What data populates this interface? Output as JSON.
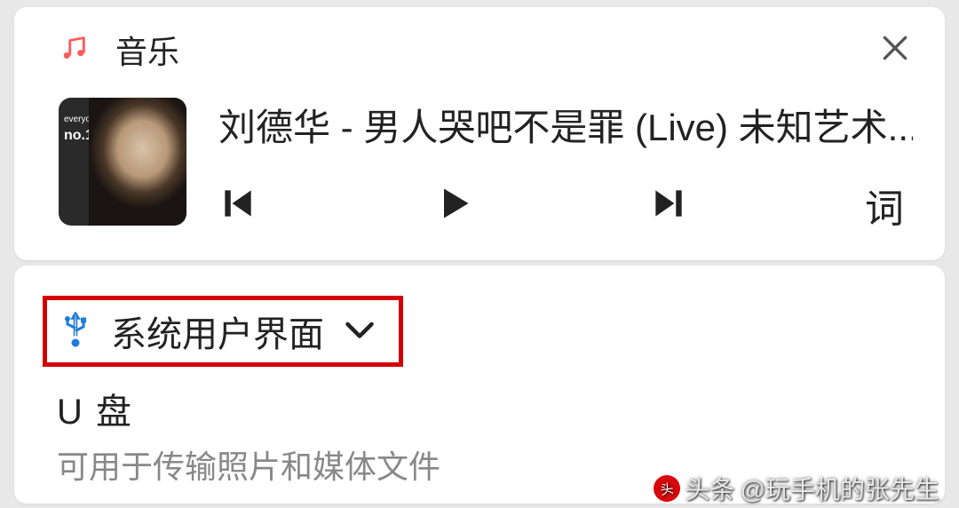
{
  "music_card": {
    "app_label": "音乐",
    "track_title": "刘德华 - 男人哭吧不是罪 (Live) 未知艺术...",
    "album_label_small": "everyone is",
    "album_label_big": "no.1",
    "lyrics_button": "词"
  },
  "system_card": {
    "system_ui_label": "系统用户界面",
    "udisk_title": "U 盘",
    "udisk_subtitle": "可用于传输照片和媒体文件"
  },
  "watermark": {
    "brand": "头条",
    "text": "@玩手机的张先生"
  }
}
